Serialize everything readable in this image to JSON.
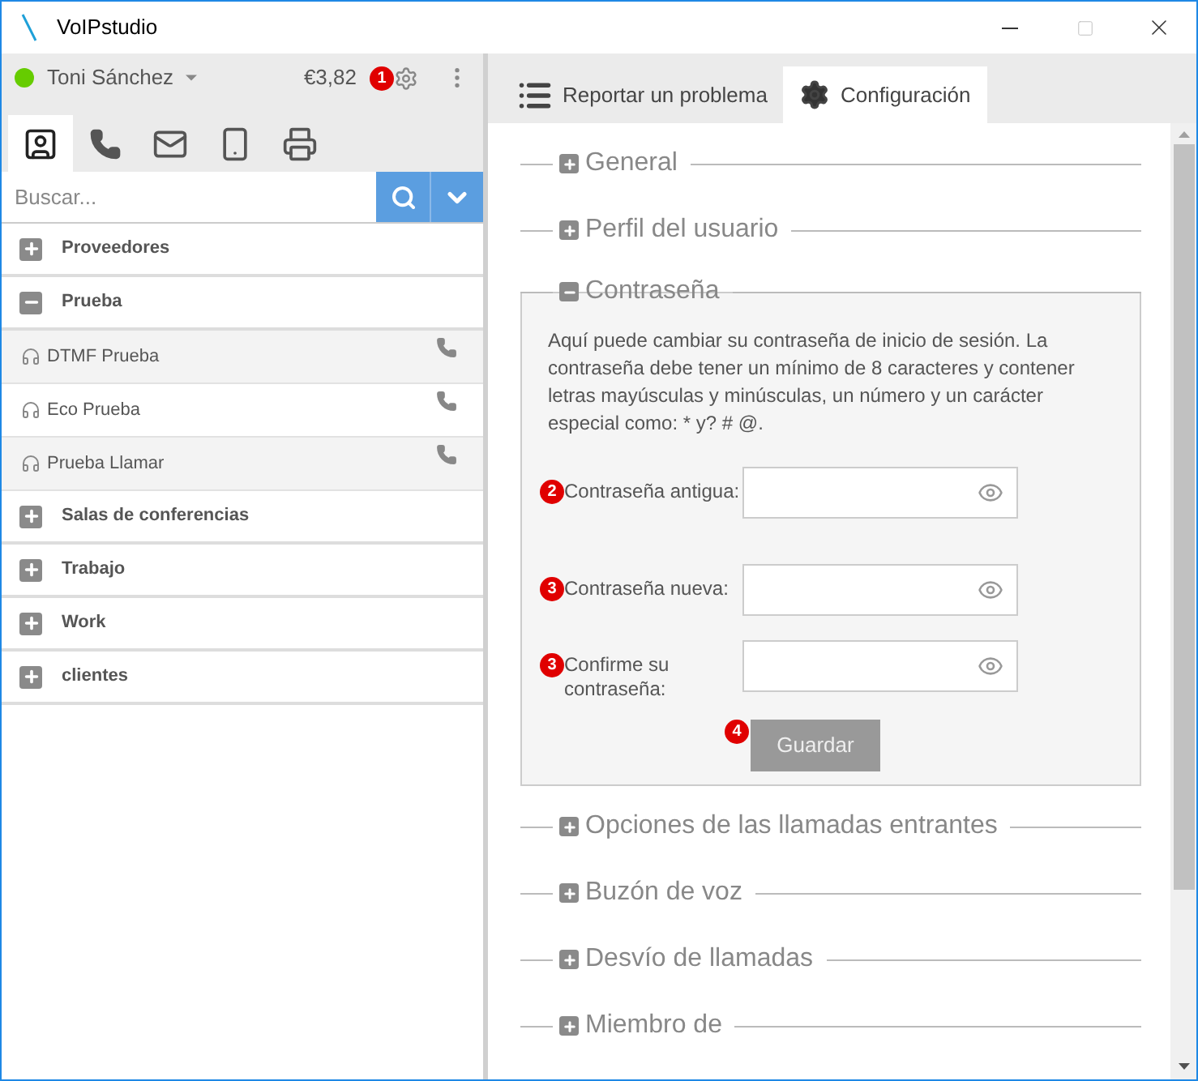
{
  "window": {
    "title": "VoIPstudio"
  },
  "user": {
    "name": "Toni Sánchez",
    "online": true,
    "balance": "€3,82",
    "badge": "1"
  },
  "contact_tabs": [
    {
      "kind": "contacts",
      "selected": true
    },
    {
      "kind": "calls",
      "selected": false
    },
    {
      "kind": "messages",
      "selected": false
    },
    {
      "kind": "mobile",
      "selected": false
    },
    {
      "kind": "fax",
      "selected": false
    }
  ],
  "search": {
    "placeholder": "Buscar..."
  },
  "groups": [
    {
      "label": "Proveedores",
      "expanded": false
    },
    {
      "label": "Prueba",
      "expanded": true,
      "children": [
        {
          "label": "DTMF Prueba"
        },
        {
          "label": "Eco Prueba"
        },
        {
          "label": "Prueba Llamar"
        }
      ]
    },
    {
      "label": "Salas de conferencias",
      "expanded": false
    },
    {
      "label": "Trabajo",
      "expanded": false
    },
    {
      "label": "Work",
      "expanded": false
    },
    {
      "label": "clientes",
      "expanded": false
    }
  ],
  "tabs": [
    {
      "label": "Reportar un problema",
      "kind": "list",
      "selected": false
    },
    {
      "label": "Configuración",
      "kind": "settings",
      "selected": true
    }
  ],
  "sections": [
    {
      "title": "General",
      "expanded": false
    },
    {
      "title": "Perfil del usuario",
      "expanded": false
    },
    {
      "title": "Contraseña",
      "expanded": true,
      "description": "Aquí puede cambiar su contraseña de inicio de sesión. La contraseña debe tener un mínimo de 8 caracteres y contener letras mayúsculas y minúsculas, un número y un carácter especial como: * y? # @.",
      "fields": [
        {
          "label": "Contraseña antigua:",
          "badge": "2"
        },
        {
          "label": "Contraseña nueva:",
          "badge": "3"
        },
        {
          "label": "Confirme su contraseña:",
          "badge": "3"
        }
      ],
      "button": {
        "label": "Guardar",
        "badge": "4",
        "disabled": true
      }
    },
    {
      "title": "Opciones de las llamadas entrantes",
      "expanded": false
    },
    {
      "title": "Buzón de voz",
      "expanded": false
    },
    {
      "title": "Desvío de llamadas",
      "expanded": false
    },
    {
      "title": "Miembro de",
      "expanded": false
    }
  ]
}
